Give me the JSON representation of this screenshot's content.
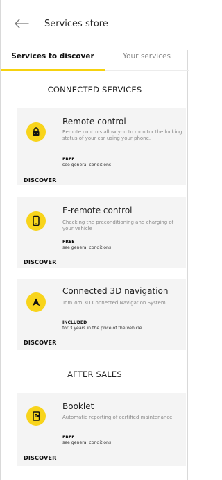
{
  "header": {
    "title": "Services store"
  },
  "tabs": [
    {
      "label": "Services to discover",
      "active": true
    },
    {
      "label": "Your services",
      "active": false
    }
  ],
  "sections": {
    "connected": "CONNECTED SERVICES",
    "after_sales": "AFTER SALES"
  },
  "accent_color": "#f6d20f",
  "cards": [
    {
      "icon": "car-lock-icon",
      "title": "Remote control",
      "description": "Remote controls allow you to monitor the locking status of your car using your phone.",
      "price": "FREE",
      "conditions": "see general conditions",
      "action": "DISCOVER"
    },
    {
      "icon": "smartphone-icon",
      "title": "E-remote control",
      "description": "Checking the preconditioning and charging of your vehicle",
      "price": "FREE",
      "conditions": "see general conditions",
      "action": "DISCOVER"
    },
    {
      "icon": "navigation-arrow-icon",
      "title": "Connected 3D navigation",
      "description": "TomTom 3D Connected Navigation System",
      "price": "INCLUDED",
      "conditions": "for 3 years in the price of the vehicle",
      "action": "DISCOVER"
    },
    {
      "icon": "booklet-icon",
      "title": "Booklet",
      "description": "Automatic reporting of certified maintenance",
      "price": "FREE",
      "conditions": "see general conditions",
      "action": "DISCOVER"
    }
  ]
}
